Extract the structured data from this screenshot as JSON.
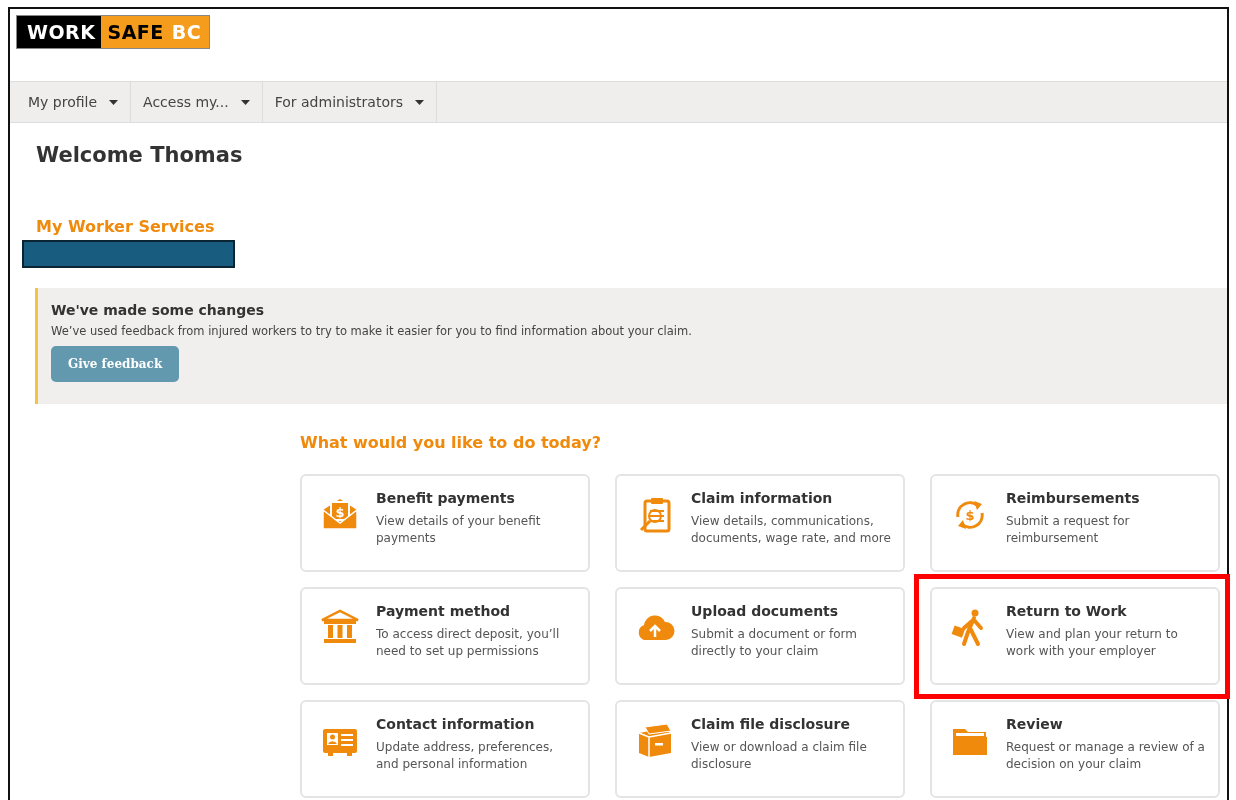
{
  "logo": [
    "WORK",
    "SAFE",
    "BC"
  ],
  "nav": [
    {
      "label": "My profile"
    },
    {
      "label": "Access my..."
    },
    {
      "label": "For administrators"
    }
  ],
  "welcome": "Welcome Thomas",
  "section_title": "My Worker Services",
  "banner": {
    "title": "We've made some changes",
    "text": "We’ve used feedback from injured workers to try to make it easier for you to find information about your claim.",
    "button": "Give feedback"
  },
  "question": "What would you like to do today?",
  "cards": [
    {
      "kind": "envelope",
      "symbol": "$",
      "title": "Benefit payments",
      "description": "View details of your benefit payments",
      "highlighted": false
    },
    {
      "kind": "clipboard",
      "title": "Claim information",
      "description": "View details, communications, documents, wage rate, and more",
      "highlighted": false
    },
    {
      "kind": "refresh",
      "symbol": "$",
      "title": "Reimbursements",
      "description": "Submit a request for reimbursement",
      "highlighted": false
    },
    {
      "kind": "bank",
      "title": "Payment method",
      "description": "To access direct deposit, you’ll need to set up permissions",
      "highlighted": false
    },
    {
      "kind": "cloud",
      "title": "Upload documents",
      "description": "Submit a document or form directly to your claim",
      "highlighted": false
    },
    {
      "kind": "walker",
      "title": "Return to Work",
      "description": "View and plan your return to work with your employer",
      "highlighted": true
    },
    {
      "kind": "idcard",
      "title": "Contact information",
      "description": "Update address, preferences, and personal information",
      "highlighted": false
    },
    {
      "kind": "box",
      "title": "Claim file disclosure",
      "description": "View or download a claim file disclosure",
      "highlighted": false
    },
    {
      "kind": "folder",
      "title": "Review",
      "description": "Request or manage a review of a decision on your claim",
      "highlighted": false
    }
  ]
}
